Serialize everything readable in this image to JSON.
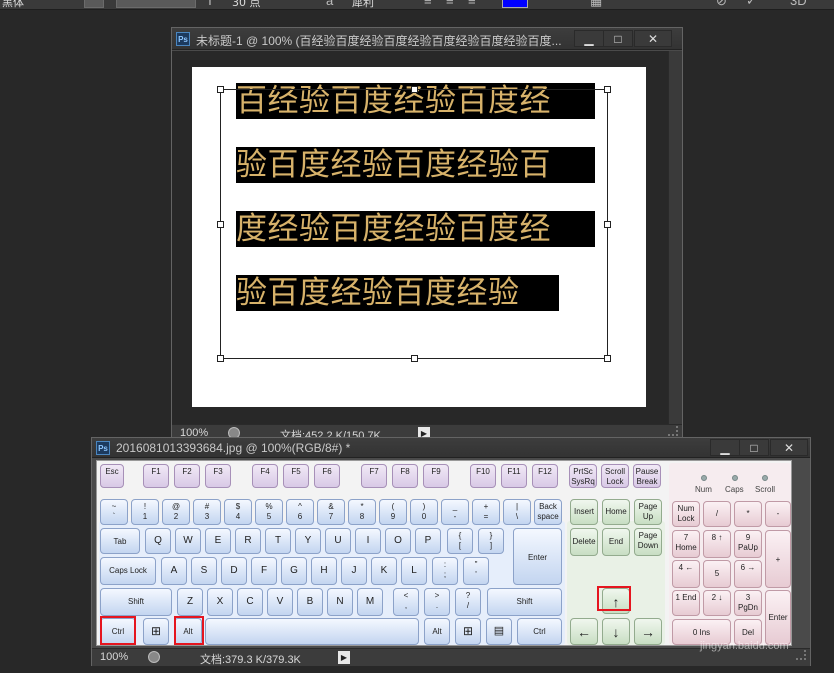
{
  "options_bar": {
    "font_style": "黑体",
    "font_size_partial": "30 点",
    "aa_mode": "犀利",
    "color": "#0000ff"
  },
  "doc1": {
    "title": "未标题-1 @ 100% (百经验百度经验百度经验百度经验百度经验百度...",
    "lines": [
      "百经验百度经验百度经",
      "验百度经验百度经验百",
      "度经验百度经验百度经",
      "验百度经验百度经验"
    ],
    "zoom": "100%",
    "doc_info": "文档:452.2 K/150.7K"
  },
  "doc2": {
    "title": "2016081013393684.jpg @ 100%(RGB/8#) *",
    "zoom": "100%",
    "doc_info": "文档:379.3 K/379.3K"
  },
  "keyboard": {
    "fn_row": [
      "Esc",
      "F1",
      "F2",
      "F3",
      "F4",
      "F5",
      "F6",
      "F7",
      "F8",
      "F9",
      "F10",
      "F11",
      "F12"
    ],
    "sys_keys": [
      "PrtSc SysRq",
      "Scroll Lock",
      "Pause Break"
    ],
    "num_row": [
      [
        "~",
        "`"
      ],
      [
        "!",
        "1"
      ],
      [
        "@",
        "2"
      ],
      [
        "#",
        "3"
      ],
      [
        "$",
        "4"
      ],
      [
        "%",
        "5"
      ],
      [
        "^",
        "6"
      ],
      [
        "&",
        "7"
      ],
      [
        "*",
        "8"
      ],
      [
        "(",
        "9"
      ],
      [
        ")",
        "0"
      ],
      [
        "_",
        "-"
      ],
      [
        "+",
        "="
      ],
      [
        "|",
        "\\"
      ]
    ],
    "backspace": "Back space",
    "tab": "Tab",
    "row_q": [
      "Q",
      "W",
      "E",
      "R",
      "T",
      "Y",
      "U",
      "I",
      "O",
      "P"
    ],
    "bracket_keys": [
      [
        "{",
        "["
      ],
      [
        "}",
        "]"
      ]
    ],
    "caps": "Caps Lock",
    "row_a": [
      "A",
      "S",
      "D",
      "F",
      "G",
      "H",
      "J",
      "K",
      "L"
    ],
    "semi_keys": [
      [
        ":",
        ";"
      ],
      [
        "\"",
        "'"
      ]
    ],
    "enter": "Enter",
    "shift_left": "Shift",
    "row_z": [
      "Z",
      "X",
      "C",
      "V",
      "B",
      "N",
      "M"
    ],
    "punct_keys": [
      [
        "<",
        ","
      ],
      [
        ">",
        "."
      ],
      [
        "?",
        "/"
      ]
    ],
    "shift_right": "Shift",
    "ctrl_left": "Ctrl",
    "win_glyph": "⊞",
    "alt_left": "Alt",
    "alt_right": "Alt",
    "menu_glyph": "▤",
    "ctrl_right": "Ctrl",
    "nav_keys": [
      "Insert",
      "Home",
      "Page Up",
      "Delete",
      "End",
      "Page Down"
    ],
    "arrows": {
      "up": "↑",
      "left": "←",
      "down": "↓",
      "right": "→"
    },
    "leds": [
      "Num",
      "Caps",
      "Scroll"
    ],
    "numpad": [
      "Num Lock",
      "/",
      "*",
      "-",
      "7 Home",
      "8 ↑",
      "9 PaUp",
      "+",
      "4 ←",
      "5",
      "6 →",
      "1 End",
      "2 ↓",
      "3 PgDn",
      "Enter",
      "0 Ins",
      "Del"
    ]
  },
  "highlight_color": "#e5151f",
  "watermark": "jingyan.baidu.com"
}
